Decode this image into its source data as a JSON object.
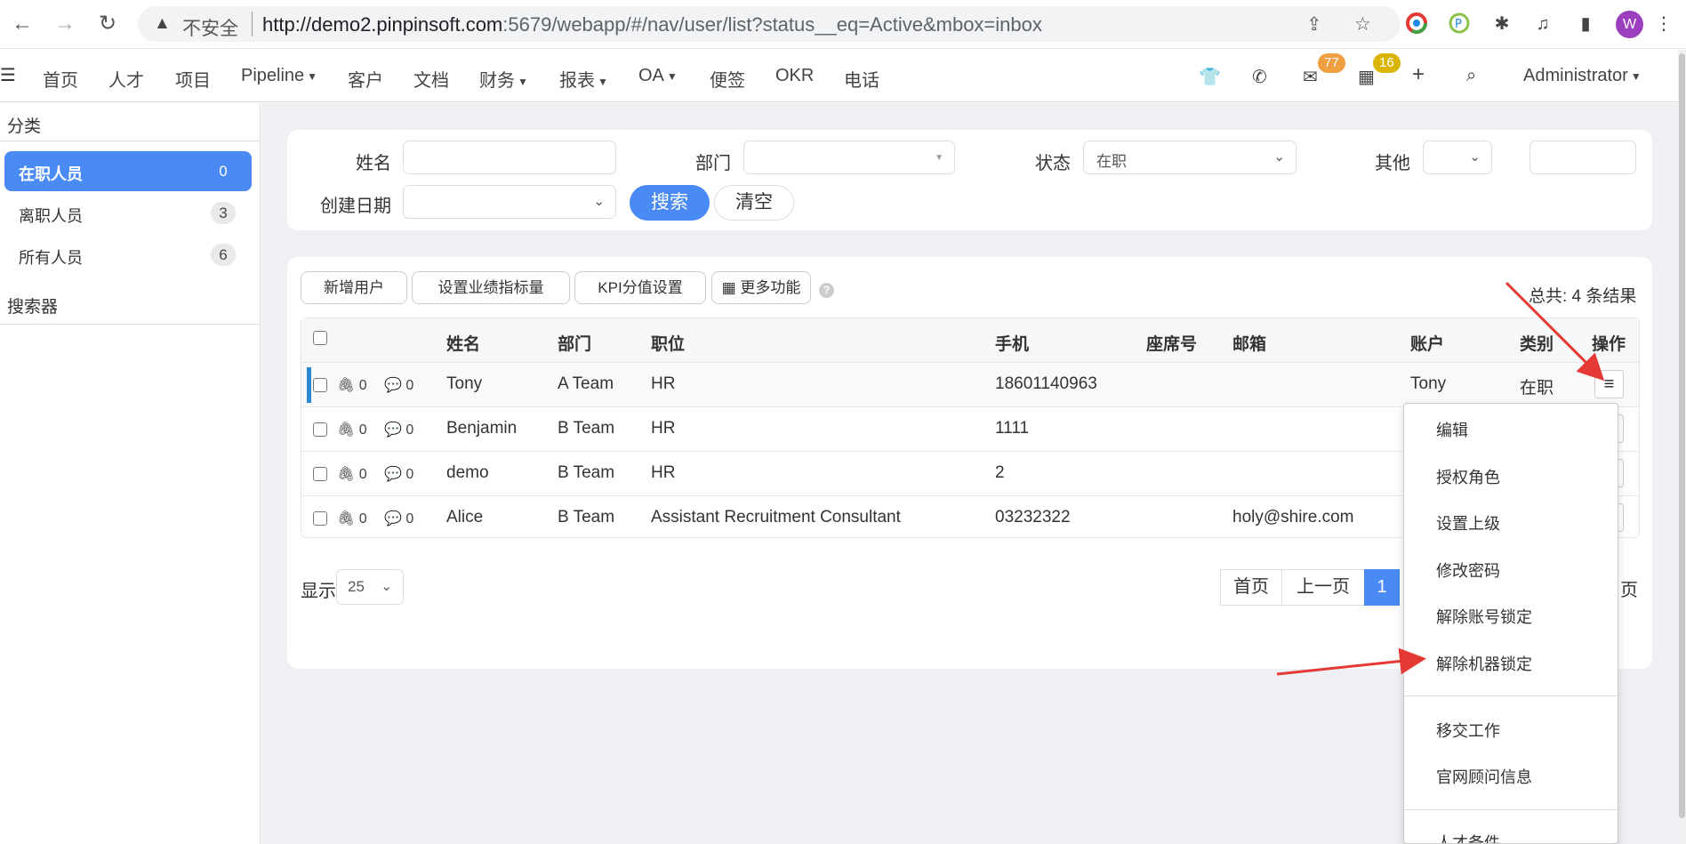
{
  "browser": {
    "insecure_label": "不安全",
    "url_host": "http://demo2.pinpinsoft.com",
    "url_rest": ":5679/webapp/#/nav/user/list?status__eq=Active&mbox=inbox",
    "profile_initial": "W"
  },
  "nav": {
    "items": [
      "首页",
      "人才",
      "项目",
      "Pipeline",
      "客户",
      "文档",
      "财务",
      "报表",
      "OA",
      "便签",
      "OKR",
      "电话"
    ],
    "mail_badge": "77",
    "calendar_badge": "16",
    "user": "Administrator"
  },
  "sidebar": {
    "category_title": "分类",
    "items": [
      {
        "label": "在职人员",
        "count": "0"
      },
      {
        "label": "离职人员",
        "count": "3"
      },
      {
        "label": "所有人员",
        "count": "6"
      }
    ],
    "searcher_title": "搜索器"
  },
  "filters": {
    "name_label": "姓名",
    "dept_label": "部门",
    "status_label": "状态",
    "status_value": "在职",
    "other_label": "其他",
    "created_label": "创建日期",
    "search_btn": "搜索",
    "clear_btn": "清空"
  },
  "toolbar": {
    "add_user": "新增用户",
    "set_kpi_target": "设置业绩指标量",
    "kpi_score": "KPI分值设置",
    "more": "更多功能",
    "help": "?",
    "total": "总共: 4 条结果"
  },
  "table": {
    "headers": [
      "姓名",
      "部门",
      "职位",
      "手机",
      "座席号",
      "邮箱",
      "账户",
      "类别",
      "操作"
    ],
    "rows": [
      {
        "attach": "0",
        "comments": "0",
        "name": "Tony",
        "dept": "A Team",
        "position": "HR",
        "phone": "18601140963",
        "seat": "",
        "email": "",
        "account": "Tony",
        "type": "在职"
      },
      {
        "attach": "0",
        "comments": "0",
        "name": "Benjamin",
        "dept": "B Team",
        "position": "HR",
        "phone": "1111",
        "seat": "",
        "email": "",
        "account": "",
        "type": ""
      },
      {
        "attach": "0",
        "comments": "0",
        "name": "demo",
        "dept": "B Team",
        "position": "HR",
        "phone": "2",
        "seat": "",
        "email": "",
        "account": "",
        "type": ""
      },
      {
        "attach": "0",
        "comments": "0",
        "name": "Alice",
        "dept": "B Team",
        "position": "Assistant Recruitment Consultant",
        "phone": "03232322",
        "seat": "",
        "email": "holy@shire.com",
        "account": "",
        "type": ""
      }
    ]
  },
  "pagination": {
    "show_label": "显示",
    "page_size": "25",
    "first": "首页",
    "prev": "上一页",
    "current": "1",
    "tail": "页"
  },
  "dropdown": {
    "items": [
      "编辑",
      "授权角色",
      "设置上级",
      "修改密码",
      "解除账号锁定",
      "解除机器锁定",
      "移交工作",
      "官网顾问信息",
      "人才备件"
    ]
  },
  "colors": {
    "accent": "#4a8af4",
    "annotation_arrow": "#e53935"
  }
}
